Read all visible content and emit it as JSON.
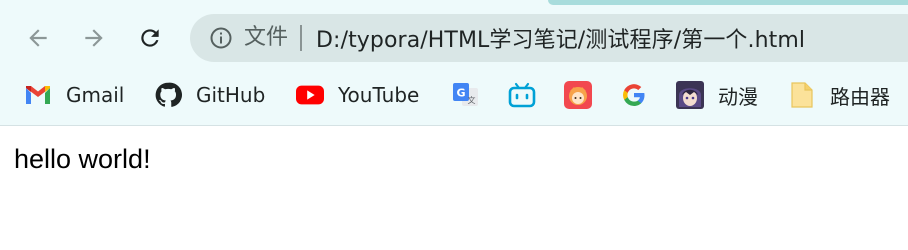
{
  "toolbar": {
    "back_icon": "arrow-left-icon",
    "forward_icon": "arrow-right-icon",
    "reload_icon": "reload-icon",
    "info_icon": "info-circle-icon",
    "chip_label": "文件",
    "url": "D:/typora/HTML学习笔记/测试程序/第一个.html"
  },
  "bookmarks": [
    {
      "label": "Gmail",
      "icon": "gmail-icon"
    },
    {
      "label": "GitHub",
      "icon": "github-icon"
    },
    {
      "label": "YouTube",
      "icon": "youtube-icon"
    },
    {
      "label": "",
      "icon": "google-translate-icon"
    },
    {
      "label": "",
      "icon": "bilibili-icon"
    },
    {
      "label": "",
      "icon": "anime-avatar-icon"
    },
    {
      "label": "",
      "icon": "google-icon"
    },
    {
      "label": "动漫",
      "icon": "anime-avatar-icon"
    },
    {
      "label": "路由器",
      "icon": "folder-icon"
    }
  ],
  "page": {
    "text": "hello world!"
  },
  "colors": {
    "chrome_bg": "#eefafb",
    "omnibox_bg": "#d9e6e6",
    "youtube_red": "#ff0000",
    "bilibili_blue": "#00a1d6"
  }
}
